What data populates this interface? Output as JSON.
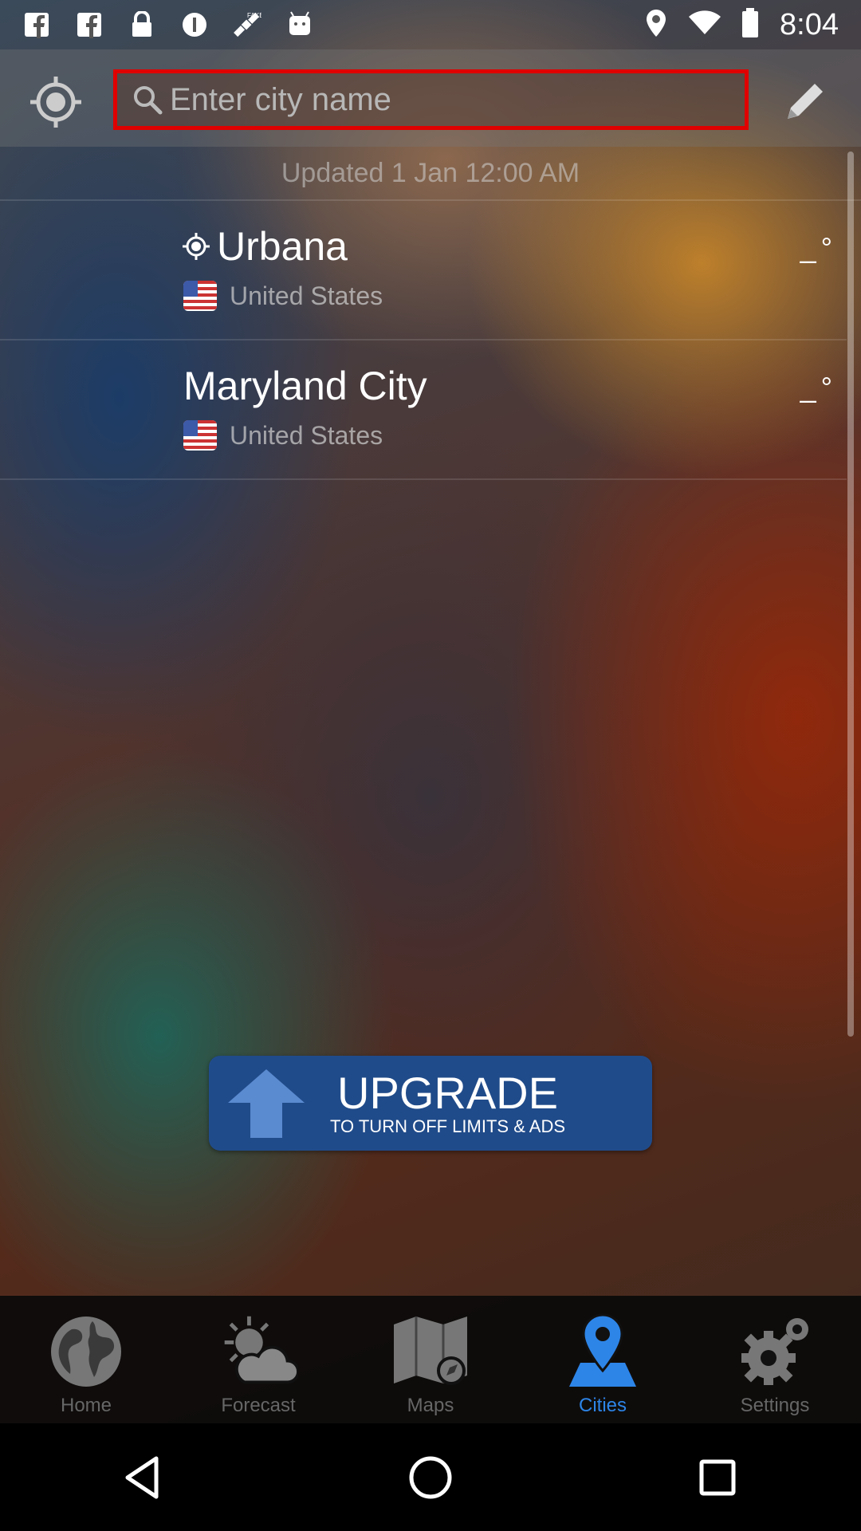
{
  "status_bar": {
    "time": "8:04",
    "icons": [
      "facebook-icon",
      "facebook-icon",
      "lock-icon",
      "info-icon",
      "satellite-icon",
      "android-icon"
    ],
    "right_icons": [
      "location-icon",
      "wifi-icon",
      "battery-icon"
    ]
  },
  "top_bar": {
    "search_placeholder": "Enter city name",
    "location_icon": "crosshair-icon",
    "edit_icon": "pencil-icon"
  },
  "list": {
    "updated": "Updated 1 Jan 12:00 AM",
    "cities": [
      {
        "name": "Urbana",
        "country": "United States",
        "temp": "_°",
        "current_location": true
      },
      {
        "name": "Maryland City",
        "country": "United States",
        "temp": "_°",
        "current_location": false
      }
    ]
  },
  "upgrade": {
    "title": "UPGRADE",
    "subtitle": "TO TURN OFF LIMITS & ADS"
  },
  "tabs": [
    {
      "label": "Home",
      "icon": "globe-icon",
      "active": false
    },
    {
      "label": "Forecast",
      "icon": "sun-cloud-icon",
      "active": false
    },
    {
      "label": "Maps",
      "icon": "map-icon",
      "active": false
    },
    {
      "label": "Cities",
      "icon": "map-pin-icon",
      "active": true
    },
    {
      "label": "Settings",
      "icon": "gear-icon",
      "active": false
    }
  ],
  "colors": {
    "accent": "#2d85e8",
    "search_border": "#e00000",
    "upgrade_bg": "#204b8a"
  }
}
